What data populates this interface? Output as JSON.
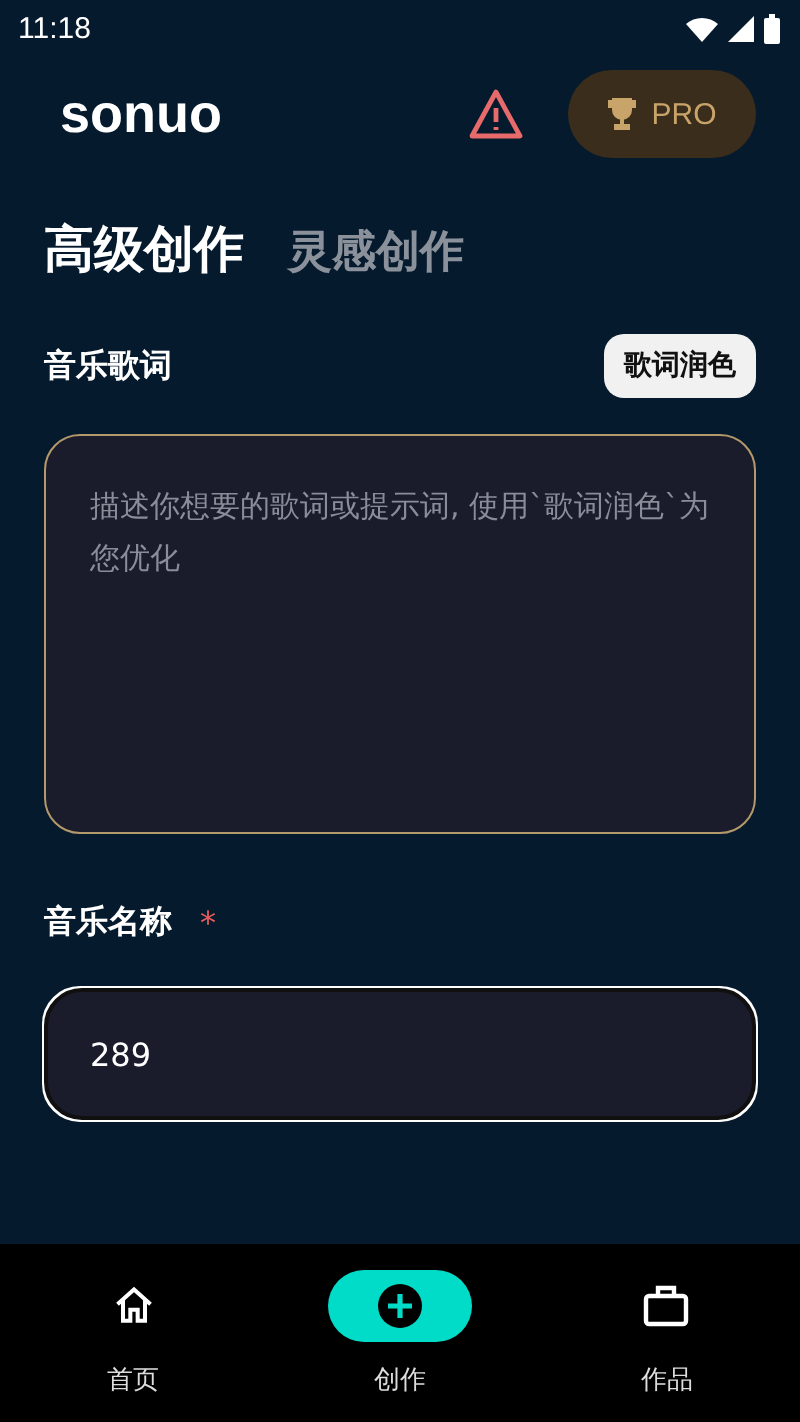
{
  "status_bar": {
    "time": "11:18"
  },
  "header": {
    "logo": "sonuo",
    "pro_label": "PRO"
  },
  "tabs": [
    {
      "label": "高级创作",
      "selected": true
    },
    {
      "label": "灵感创作",
      "selected": false
    }
  ],
  "lyrics": {
    "label": "音乐歌词",
    "polish_button": "歌词润色",
    "placeholder": "描述你想要的歌词或提示词, 使用`歌词润色`为您优化"
  },
  "music_name": {
    "label": "音乐名称",
    "required_mark": "*",
    "value": "289"
  },
  "nav": [
    {
      "label": "首页",
      "kind": "home",
      "selected": false
    },
    {
      "label": "创作",
      "kind": "create",
      "selected": true
    },
    {
      "label": "作品",
      "kind": "works",
      "selected": false
    }
  ]
}
